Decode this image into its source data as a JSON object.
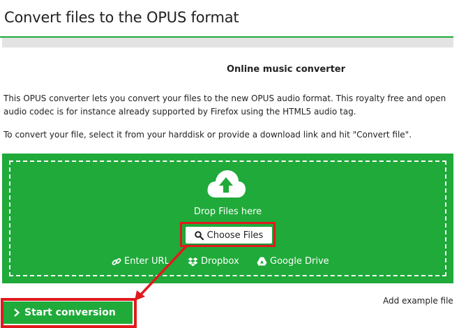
{
  "header": {
    "title": "Convert files to the OPUS format"
  },
  "main": {
    "subheading": "Online music converter",
    "description": "This OPUS converter lets you convert your files to the new OPUS audio format. This royalty free and open audio codec is for instance already supported by Firefox using the HTML5 audio tag.",
    "instructions": "To convert your file, select it from your harddisk or provide a download link and hit \"Convert file\"."
  },
  "dropzone": {
    "drop_text": "Drop Files here",
    "choose_label": "Choose Files",
    "enter_url_label": "Enter URL",
    "dropbox_label": "Dropbox",
    "drive_label": "Google Drive"
  },
  "actions": {
    "start_label": "Start conversion",
    "example_label": "Add example file"
  },
  "colors": {
    "brand_green": "#1faa39",
    "highlight_red": "#e0191f"
  },
  "icons": [
    "cloud-upload-icon",
    "search-icon",
    "link-icon",
    "dropbox-icon",
    "google-drive-icon",
    "chevron-right-icon"
  ]
}
